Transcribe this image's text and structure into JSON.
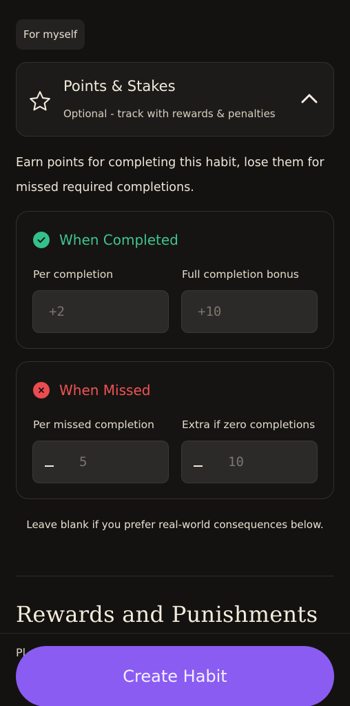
{
  "for_chip": "For myself",
  "stakes": {
    "title": "Points & Stakes",
    "subtitle": "Optional - track with rewards & penalties"
  },
  "description": "Earn points for completing this habit, lose them for missed required completions.",
  "completed_card": {
    "title": "When Completed",
    "per_label": "Per completion",
    "bonus_label": "Full completion bonus",
    "per_placeholder": "+2",
    "bonus_placeholder": "+10"
  },
  "missed_card": {
    "title": "When Missed",
    "per_label": "Per missed completion",
    "extra_label": "Extra if zero completions",
    "per_placeholder": "5",
    "extra_placeholder": "10"
  },
  "note": "Leave blank if you prefer real-world consequences below.",
  "section_title": "Rewards and Punishments",
  "peek_text": "Pl",
  "create_button": "Create Habit",
  "colors": {
    "accent": "#8a5cf2",
    "success": "#3ec490",
    "danger": "#ef5356"
  }
}
